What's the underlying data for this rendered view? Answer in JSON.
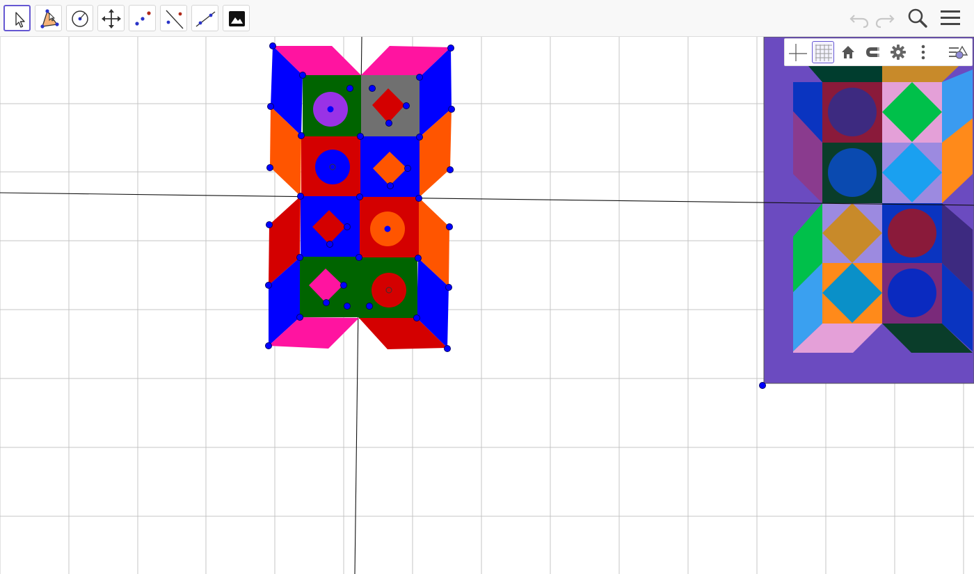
{
  "colors": {
    "accent": "#6557d2",
    "point": "#0000ff",
    "grid": "#c0c0c0",
    "axis": "#000000",
    "magenta": "#ff14a0",
    "blue": "#0000ff",
    "orange": "#ff5500",
    "red": "#d40000",
    "dark_green": "#006400",
    "gray": "#707070",
    "purple": "#9932e6",
    "painting_bg": "#6b4bc0"
  },
  "toolbar": {
    "tools": [
      {
        "icon": "move-arrow-icon",
        "active": true
      },
      {
        "icon": "polygon-icon",
        "active": false
      },
      {
        "icon": "circle-with-center-icon",
        "active": false
      },
      {
        "icon": "move-graphics-view-icon",
        "active": false
      },
      {
        "icon": "point-icon",
        "active": false
      },
      {
        "icon": "line-through-point-icon",
        "active": false
      },
      {
        "icon": "segment-icon",
        "active": false
      },
      {
        "icon": "image-icon",
        "active": false
      }
    ],
    "right": [
      "undo-icon",
      "redo-icon",
      "search-icon",
      "menu-icon"
    ]
  },
  "stylebar": {
    "buttons": [
      {
        "icon": "axes-icon",
        "active": false
      },
      {
        "icon": "grid-icon",
        "active": true
      },
      {
        "icon": "home-icon",
        "active": false
      },
      {
        "icon": "magnet-snap-icon",
        "active": false
      },
      {
        "icon": "settings-gear-icon",
        "active": false
      },
      {
        "icon": "more-vertical-icon",
        "active": false
      },
      {
        "icon": "toggle-style-bar-icon",
        "active": false
      }
    ]
  },
  "graphics": {
    "grid": true,
    "axes": true,
    "inserted_image": "vasarely-style-painting"
  }
}
